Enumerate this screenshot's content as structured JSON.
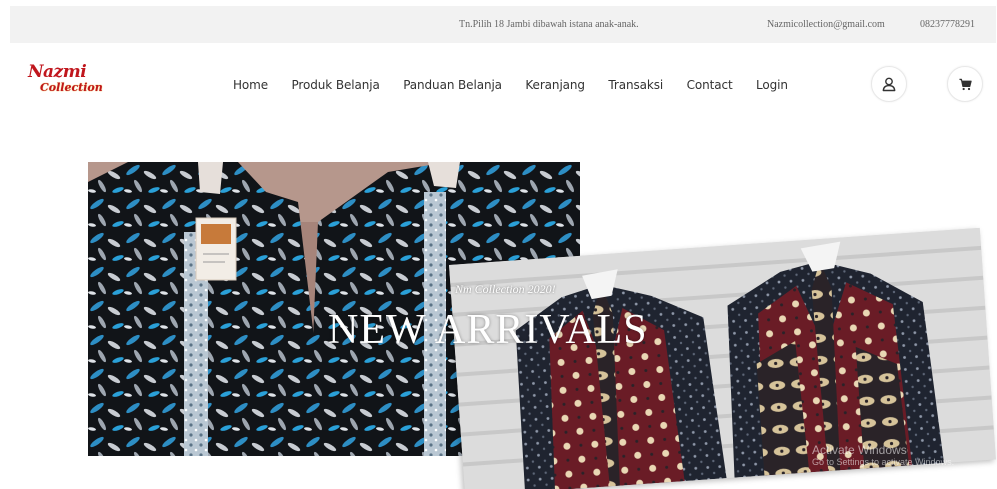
{
  "topbar": {
    "address": "Tn.Pilih 18 Jambi dibawah istana anak-anak.",
    "email": "Nazmicollection@gmail.com",
    "phone": "08237778291"
  },
  "logo": {
    "line1": "Nazmi",
    "line2": "Collection"
  },
  "nav": {
    "items": [
      "Home",
      "Produk Belanja",
      "Panduan Belanja",
      "Keranjang",
      "Transaksi",
      "Contact",
      "Login"
    ]
  },
  "icons": {
    "user": "user-icon",
    "cart": "cart-icon"
  },
  "hero": {
    "subtitle": "Nm Collection 2020!",
    "title": "NEW ARRIVALS"
  },
  "watermark": {
    "line1": "Activate Windows",
    "line2": "Go to Settings to activate Windows."
  },
  "colors": {
    "logo": "#c0161d",
    "topbar_bg": "#f2f2f2",
    "nav_text": "#333333"
  }
}
